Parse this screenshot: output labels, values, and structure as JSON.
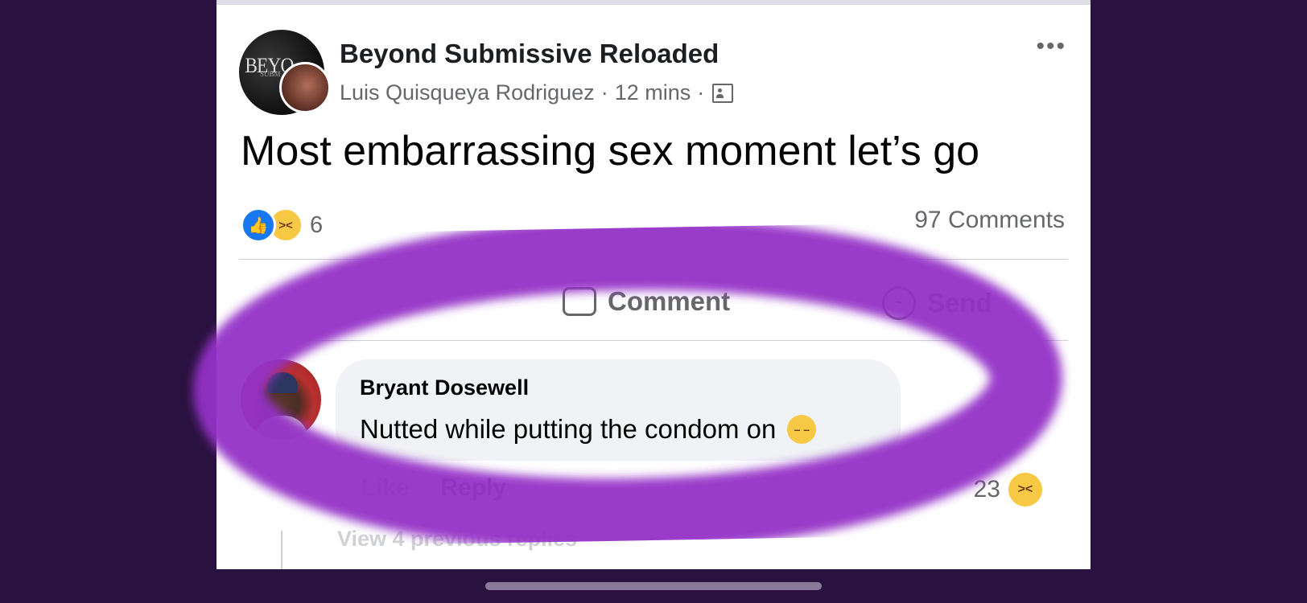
{
  "post": {
    "group_name": "Beyond Submissive Reloaded",
    "author": "Luis Quisqueya Rodriguez",
    "time": "12 mins",
    "separator": "·",
    "more": "•••",
    "text": "Most embarrassing sex moment let’s go",
    "reaction_count": "6",
    "comments_count": "97 Comments",
    "logo_text": "BEYO",
    "logo_sub": "SUBM",
    "actions": {
      "comment": "Comment",
      "send": "Send"
    }
  },
  "comment": {
    "name": "Bryant Dosewell",
    "text": "Nutted while putting the condom on",
    "like": "Like",
    "reply": "Reply",
    "reaction_count": "23",
    "view_replies": "View 4 previous replies"
  },
  "icons": {
    "like": "like-icon",
    "haha": "haha-icon",
    "sad": "pensive-face-icon",
    "audience": "group-audience-icon",
    "more": "more-options-icon",
    "comment": "comment-icon",
    "send": "messenger-icon"
  },
  "colors": {
    "background": "#2a1240",
    "highlight_ring": "#9433c7",
    "like_blue": "#1877f2",
    "emoji_yellow": "#f7c843"
  }
}
